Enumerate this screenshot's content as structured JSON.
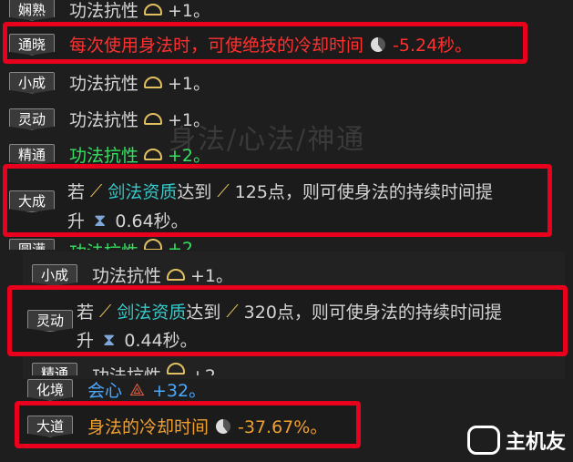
{
  "background_title": "身法/心法/神通",
  "rows": {
    "r0": {
      "badge": "娴熟",
      "text": "功法抗性",
      "value": "+1。"
    },
    "r1": {
      "badge": "通晓",
      "text": "每次使用身法时，可使绝技的冷却时间",
      "value": "-5.24秒。"
    },
    "r2": {
      "badge": "小成",
      "text": "功法抗性",
      "value": "+1。"
    },
    "r3": {
      "badge": "灵动",
      "text": "功法抗性",
      "value": "+1。"
    },
    "r4": {
      "badge": "精通",
      "text": "功法抗性",
      "value": "+2。"
    },
    "r5": {
      "badge": "大成",
      "pre": "若",
      "attr": "剑法资质",
      "mid": "达到",
      "num": "125点，则可使身法的持续时间提",
      "line2a": "升",
      "line2b": "0.64秒。"
    },
    "r6": {
      "badge": "圆满",
      "text": "功法抗性",
      "value": "+2"
    },
    "r7": {
      "badge": "小成",
      "text": "功法抗性",
      "value": "+1。"
    },
    "r8": {
      "badge": "灵动",
      "pre": "若",
      "attr": "剑法资质",
      "mid": "达到",
      "num": "320点，则可使身法的持续时间提",
      "line2a": "升",
      "line2b": "0.44秒。"
    },
    "r9": {
      "badge": "精通",
      "text": "功法抗性",
      "value": "+2。"
    },
    "r10": {
      "badge": "化境",
      "text": "会心",
      "value": "+32。"
    },
    "r11": {
      "badge": "大道",
      "text": "身法的冷却时间",
      "value": "-37.67%。"
    }
  },
  "watermark": "主机友",
  "colors": {
    "highlight": "#e8001c",
    "green": "#35e060",
    "cyan": "#36c8c8",
    "orange": "#f0a030",
    "red": "#ff3030"
  }
}
